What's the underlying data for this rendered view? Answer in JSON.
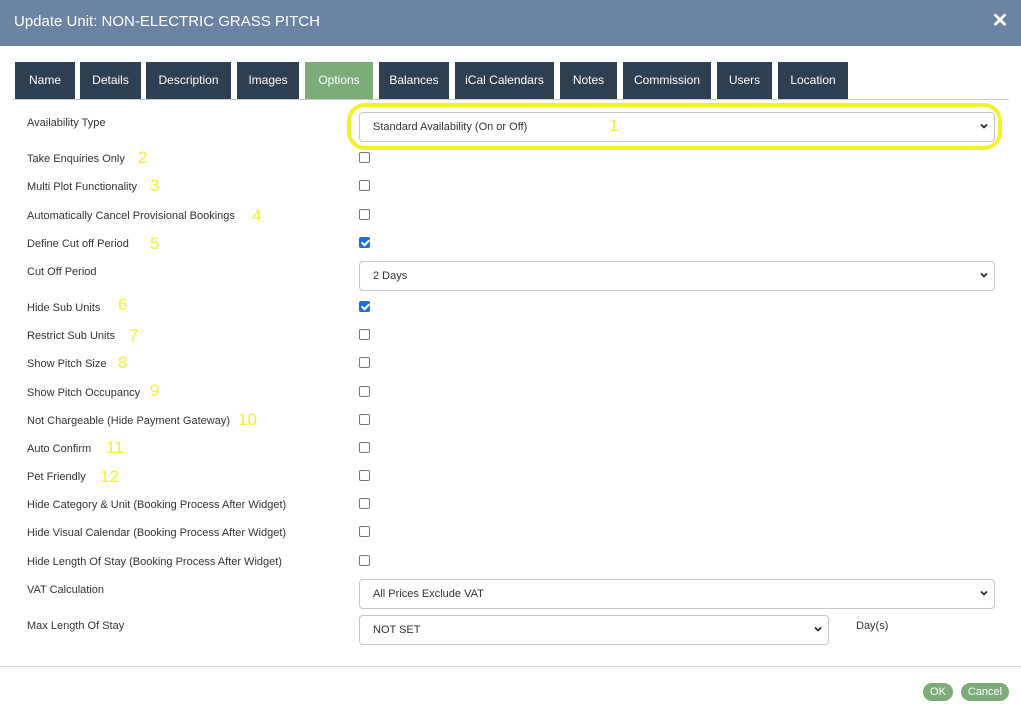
{
  "window": {
    "title": "Update Unit: NON-ELECTRIC GRASS PITCH",
    "close_icon": "close-icon"
  },
  "tabs": [
    {
      "label": "Name"
    },
    {
      "label": "Details"
    },
    {
      "label": "Description"
    },
    {
      "label": "Images"
    },
    {
      "label": "Options",
      "active": true
    },
    {
      "label": "Balances"
    },
    {
      "label": "iCal Calendars"
    },
    {
      "label": "Notes"
    },
    {
      "label": "Commission"
    },
    {
      "label": "Users"
    },
    {
      "label": "Location"
    }
  ],
  "form": {
    "availability_type": {
      "label": "Availability Type",
      "value": "Standard Availability (On or Off)",
      "annotation": "1"
    },
    "take_enquiries_only": {
      "label": "Take Enquiries Only",
      "checked": false,
      "annotation": "2"
    },
    "multi_plot": {
      "label": "Multi Plot Functionality",
      "checked": false,
      "annotation": "3"
    },
    "auto_cancel": {
      "label": "Automatically Cancel Provisional Bookings",
      "checked": false,
      "annotation": "4"
    },
    "define_cutoff": {
      "label": "Define Cut off Period",
      "checked": true,
      "annotation": "5"
    },
    "cutoff_period": {
      "label": "Cut Off Period",
      "value": "2 Days"
    },
    "hide_sub_units": {
      "label": "Hide Sub Units",
      "checked": true,
      "annotation": "6"
    },
    "restrict_sub_units": {
      "label": "Restrict Sub Units",
      "checked": false,
      "annotation": "7"
    },
    "show_pitch_size": {
      "label": "Show Pitch Size",
      "checked": false,
      "annotation": "8"
    },
    "show_pitch_occupancy": {
      "label": "Show Pitch Occupancy",
      "checked": false,
      "annotation": "9"
    },
    "not_chargeable": {
      "label": "Not Chargeable (Hide Payment Gateway)",
      "checked": false,
      "annotation": "10"
    },
    "auto_confirm": {
      "label": "Auto Confirm",
      "checked": false,
      "annotation": "11"
    },
    "pet_friendly": {
      "label": "Pet Friendly",
      "checked": false,
      "annotation": "12"
    },
    "hide_category_unit": {
      "label": "Hide Category & Unit (Booking Process After Widget)",
      "checked": false
    },
    "hide_visual_calendar": {
      "label": "Hide Visual Calendar (Booking Process After Widget)",
      "checked": false
    },
    "hide_length_of_stay": {
      "label": "Hide Length Of Stay (Booking Process After Widget)",
      "checked": false
    },
    "vat_calculation": {
      "label": "VAT Calculation",
      "value": "All Prices Exclude VAT"
    },
    "max_length_of_stay": {
      "label": "Max Length Of Stay",
      "value": "NOT SET",
      "unit": "Day(s)"
    }
  },
  "footer": {
    "ok_label": "OK",
    "cancel_label": "Cancel"
  },
  "colors": {
    "header": "#6b84a3",
    "tab": "#2e3f52",
    "tab_active": "#7cad78",
    "annotation": "#f4f12a",
    "checkbox_on": "#1e6fd9"
  }
}
